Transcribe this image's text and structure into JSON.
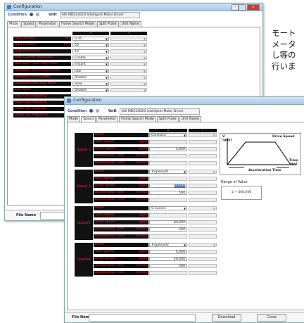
{
  "side_text": "モート\nメータ\nし等の\n行いま",
  "back_window": {
    "title": "Configuration",
    "condition_label": "Condition",
    "unit_label": "Unit",
    "unit_value": "6th MDS1302D Intelligent Motor Driver",
    "tabs": [
      "Mode",
      "Speed",
      "Parameter",
      "Home Search Mode",
      "Split Pulse",
      "Unit Name"
    ],
    "columns": [
      "X",
      "Y"
    ],
    "rows": [
      {
        "label": "Run Current",
        "unit": "[A]",
        "x": "0.35"
      },
      {
        "label": "Hold Current",
        "unit": "[%]",
        "x": "50"
      },
      {
        "label": "Step Resolution",
        "unit": "",
        "x": "10"
      },
      {
        "label": "Auto Current Reduction",
        "unit": "",
        "x": "Enable"
      },
      {
        "label": "Hardware Limit Stop Mode",
        "unit": "",
        "x": "Instant"
      },
      {
        "label": "Hardware Limit Active Level",
        "unit": "",
        "x": "Low"
      },
      {
        "label": "Software Limit Enable",
        "unit": "",
        "x": "Disable"
      },
      {
        "label": "Software Limit Stop Mode",
        "unit": "",
        "x": "Slow"
      },
      {
        "label": "Enc Pulse",
        "unit": "",
        "x": "Disable"
      },
      {
        "label": "Stop Out Outputing",
        "unit": "",
        "x": ""
      },
      {
        "label": "Stop Out Outputing",
        "unit": "",
        "x": ""
      },
      {
        "label": "Power On Home Se",
        "unit": "",
        "x": ""
      },
      {
        "label": "Power On Program S",
        "unit": "",
        "x": ""
      }
    ],
    "file_name_label": "File Name"
  },
  "front_window": {
    "title": "Configuration",
    "condition_label": "Condition",
    "unit_label": "Unit",
    "unit_value": "6th MDS1302D Intelligent Motor Driver",
    "tabs": [
      "Mode",
      "Speed",
      "Parameter",
      "Home Search Mode",
      "Split Pulse",
      "Unit Name"
    ],
    "active_tab": "Speed",
    "columns": [
      "X",
      "Y"
    ],
    "groups": [
      {
        "name": "Speed 1",
        "rows": [
          {
            "label": "Mode",
            "unit": "",
            "value": "Constant",
            "kind": "select"
          },
          {
            "label": "Start Speed",
            "unit": "[pps]",
            "value": "",
            "kind": "grey"
          },
          {
            "label": "Drive Speed",
            "unit": "[pps]",
            "value": "4,000",
            "kind": "input"
          },
          {
            "label": "Acceleration Time",
            "unit": "[msec]",
            "value": "",
            "kind": "grey"
          },
          {
            "label": "Deceleration Time",
            "unit": "[msec]",
            "value": "",
            "kind": "grey"
          }
        ]
      },
      {
        "name": "Speed 2",
        "rows": [
          {
            "label": "Mode",
            "unit": "",
            "value": "Trapezoid1",
            "kind": "select"
          },
          {
            "label": "Start Speed",
            "unit": "[pps]",
            "value": "",
            "kind": "grey"
          },
          {
            "label": "Drive Speed",
            "unit": "[pps]",
            "value": "40000",
            "kind": "input-hl"
          },
          {
            "label": "Acceleration Time",
            "unit": "[msec]",
            "value": "500",
            "kind": "input"
          },
          {
            "label": "Deceleration Time",
            "unit": "[msec]",
            "value": "",
            "kind": "grey"
          }
        ]
      },
      {
        "name": "Speed3",
        "rows": [
          {
            "label": "Mode",
            "unit": "",
            "value": "S-Curve1",
            "kind": "select"
          },
          {
            "label": "Start Speed",
            "unit": "[pps]",
            "value": "",
            "kind": "grey"
          },
          {
            "label": "Drive Speed",
            "unit": "[pps]",
            "value": "80,000",
            "kind": "input"
          },
          {
            "label": "Acceleration Time",
            "unit": "[msec]",
            "value": "500",
            "kind": "input"
          },
          {
            "label": "Deceleration Time",
            "unit": "[msec]",
            "value": "",
            "kind": "grey"
          }
        ]
      },
      {
        "name": "Speed4",
        "rows": [
          {
            "label": "Mode",
            "unit": "",
            "value": "Trapezoid2",
            "kind": "select"
          },
          {
            "label": "Start Speed",
            "unit": "[pps]",
            "value": "4,000",
            "kind": "input"
          },
          {
            "label": "Drive Speed",
            "unit": "[pps]",
            "value": "40,000",
            "kind": "input"
          },
          {
            "label": "Acceleration Time",
            "unit": "[msec]",
            "value": "500",
            "kind": "input"
          },
          {
            "label": "Deceleration Time",
            "unit": "[msec]",
            "value": "",
            "kind": "grey"
          }
        ]
      }
    ],
    "diagram": {
      "y_label": "V\n(pps)",
      "x_label": "Time\n(ms)",
      "drive_speed_label": "Drive Speed",
      "accel_label": "Acceleration Time"
    },
    "range_label": "Range of Value",
    "range_value": "1 ~ 500,000",
    "file_name_label": "File Name",
    "download_label": "Download",
    "close_label": "Close"
  }
}
